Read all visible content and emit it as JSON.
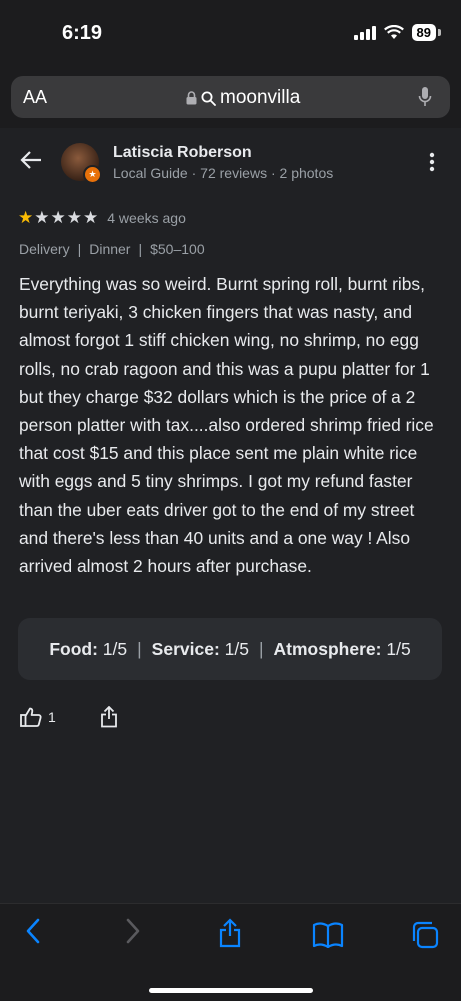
{
  "status_bar": {
    "time": "6:19",
    "battery": "89"
  },
  "address_bar": {
    "text_size_label": "AA",
    "url": "moonvilla"
  },
  "reviewer": {
    "name": "Latiscia Roberson",
    "meta": "Local Guide · 72 reviews · 2 photos"
  },
  "review": {
    "rating": 1,
    "max_rating": 5,
    "time_ago": "4 weeks ago",
    "tags": [
      "Delivery",
      "Dinner",
      "$50–100"
    ],
    "text": "Everything was so weird. Burnt spring roll, burnt ribs, burnt teriyaki, 3 chicken fingers that was nasty, and almost forgot 1 stiff chicken wing, no shrimp, no egg rolls, no crab ragoon and this was a pupu platter for 1 but they charge $32 dollars which is the price of a 2 person platter with tax....also ordered shrimp fried rice that cost $15 and this place sent me plain white rice with eggs and 5 tiny shrimps. I got my refund faster than the uber eats driver got to the end of my street and there's less than 40 units and a one way ! Also arrived almost 2 hours after purchase.",
    "attributes": [
      {
        "label": "Food:",
        "value": "1/5"
      },
      {
        "label": "Service:",
        "value": "1/5"
      },
      {
        "label": "Atmosphere:",
        "value": "1/5"
      }
    ],
    "like_count": "1"
  },
  "colors": {
    "background": "#202124",
    "star": "#fbbc04",
    "accent": "#0a84ff",
    "guide_badge": "#e8710a"
  },
  "icons": [
    "back-arrow-icon",
    "more-vert-icon",
    "lock-icon",
    "search-icon",
    "mic-icon",
    "thumb-up-icon",
    "share-icon",
    "bookmarks-icon",
    "tabs-icon"
  ]
}
